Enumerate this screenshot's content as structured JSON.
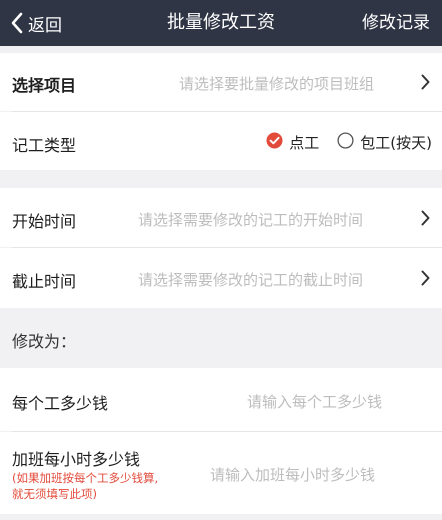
{
  "nav": {
    "back_label": "返回",
    "title": "批量修改工资",
    "right_label": "修改记录"
  },
  "project": {
    "label": "选择项目",
    "placeholder": "请选择要批量修改的项目班组"
  },
  "work_type": {
    "label": "记工类型",
    "options": [
      {
        "label": "点工",
        "selected": true
      },
      {
        "label": "包工(按天)",
        "selected": false
      }
    ]
  },
  "start_time": {
    "label": "开始时间",
    "placeholder": "请选择需要修改的记工的开始时间"
  },
  "end_time": {
    "label": "截止时间",
    "placeholder": "请选择需要修改的记工的截止时间"
  },
  "modify_section": {
    "label": "修改为："
  },
  "per_day": {
    "label": "每个工多少钱",
    "placeholder": "请输入每个工多少钱"
  },
  "overtime": {
    "label": "加班每小时多少钱",
    "note_line1": "(如果加班按每个工多少钱算,",
    "note_line2": "就无须填写此项)",
    "placeholder": "请输入加班每小时多少钱"
  },
  "colors": {
    "navbar_bg": "#2f3545",
    "accent_red": "#e24a3a",
    "page_bg": "#f1f1f3"
  },
  "icons": {
    "back": "chevron-left-icon",
    "disclosure": "chevron-right-icon",
    "radio_on": "radio-checked-icon",
    "radio_off": "radio-unchecked-icon"
  }
}
